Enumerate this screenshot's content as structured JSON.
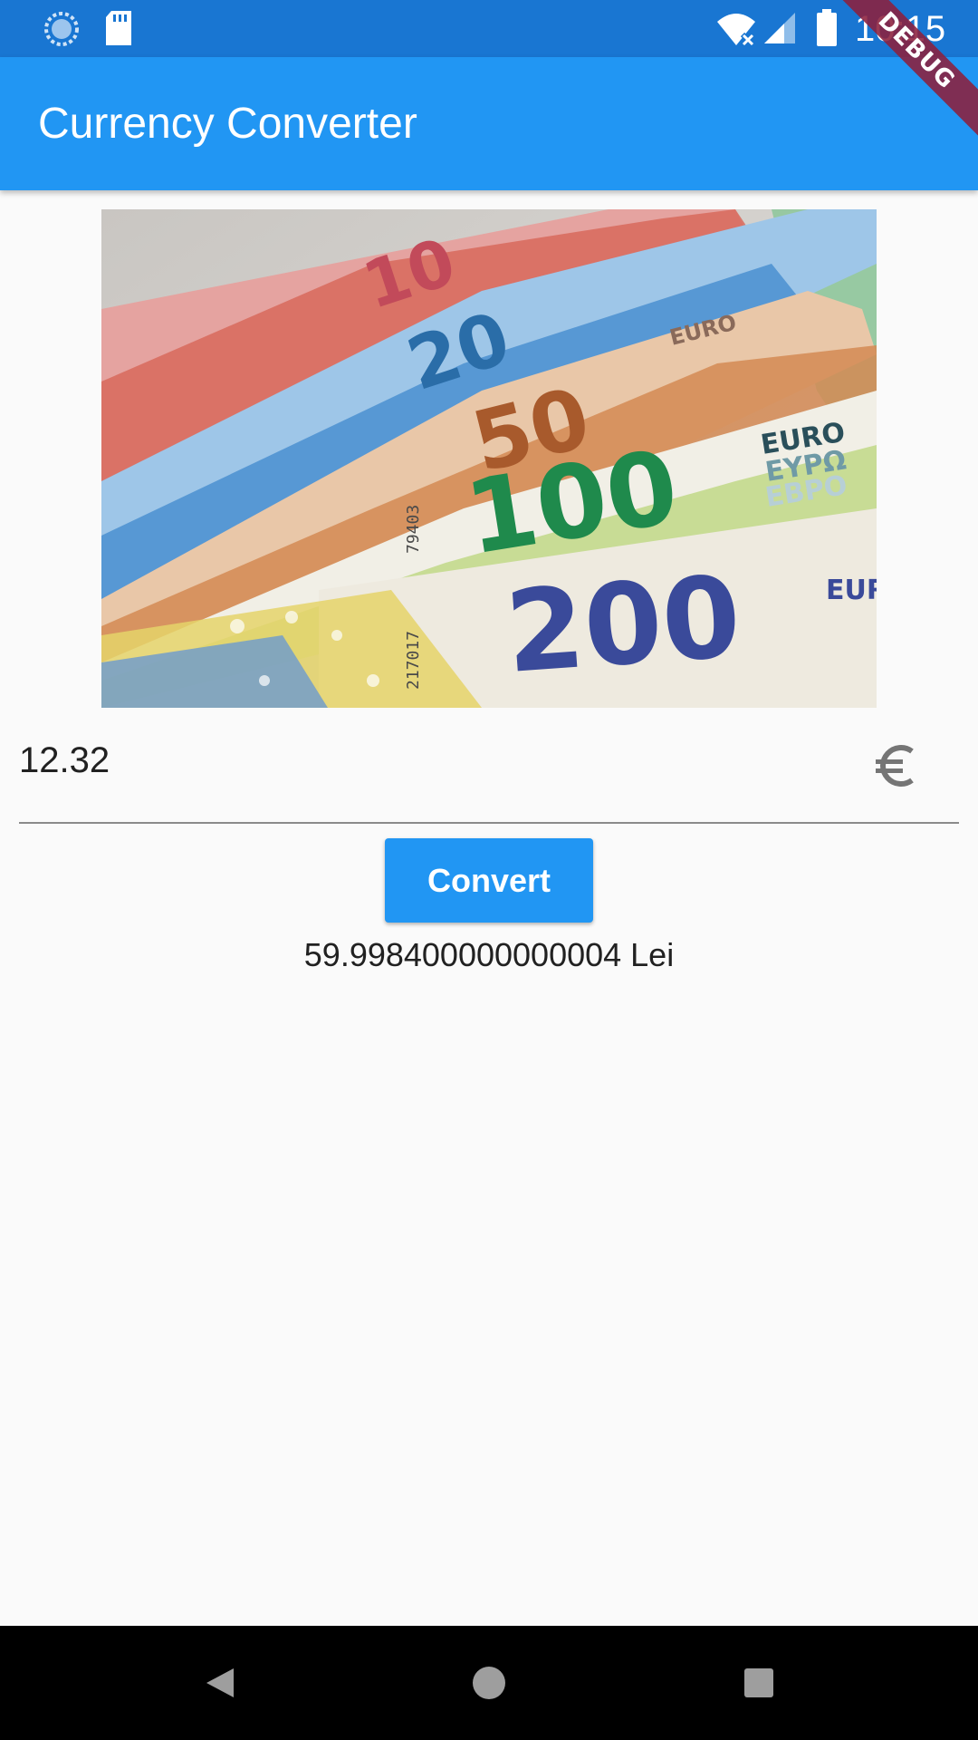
{
  "status_bar": {
    "time": "10:15",
    "icons": [
      "sync-icon",
      "sd-card-icon",
      "wifi-off-icon",
      "cell-signal-icon",
      "battery-icon"
    ]
  },
  "app_bar": {
    "title": "Currency Converter",
    "color": "#2196f3"
  },
  "debug_banner": {
    "label": "DEBUG"
  },
  "money_image": {
    "note_values": [
      "10",
      "20",
      "50",
      "100",
      "200"
    ],
    "note_texts": [
      "EURO",
      "ΕΥΡΩ",
      "ЕВРО"
    ],
    "serial_texts": [
      "79403",
      "217017"
    ]
  },
  "amount_input": {
    "value": "12.32",
    "suffix_icon": "euro-icon"
  },
  "convert_button": {
    "label": "Convert",
    "color": "#2196f3"
  },
  "result": {
    "text": "59.998400000000004 Lei"
  },
  "nav_bar": {
    "icons": [
      "back-icon",
      "home-icon",
      "recents-icon"
    ]
  }
}
